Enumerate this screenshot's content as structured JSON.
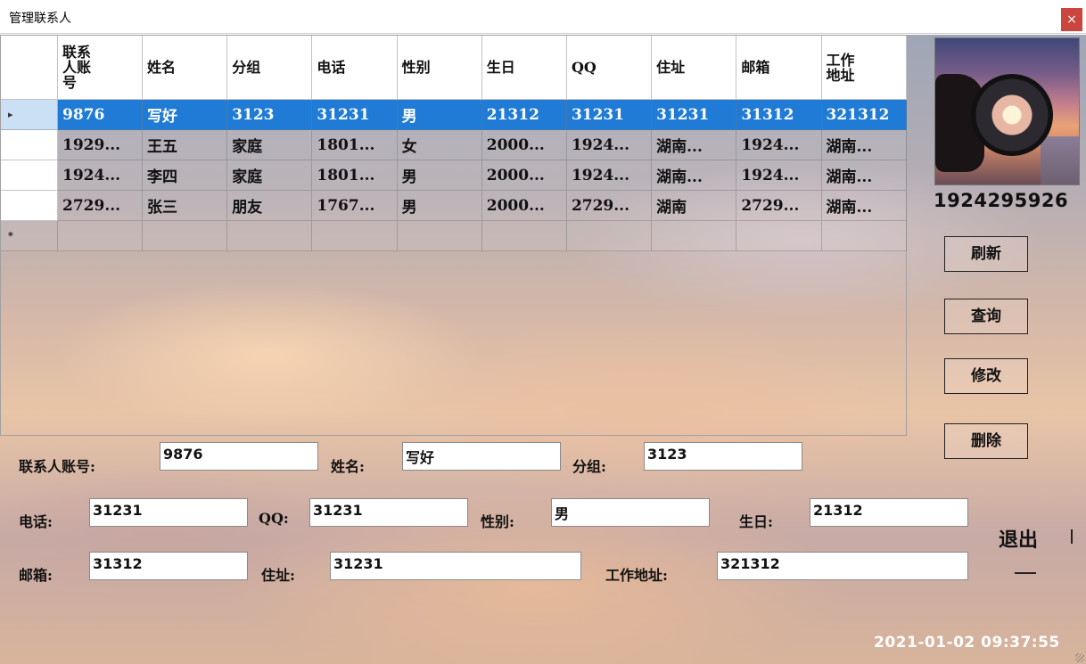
{
  "window": {
    "title": "管理联系人",
    "close_glyph": "×"
  },
  "grid": {
    "columns": [
      "联系\n人账\n号",
      "姓名",
      "分组",
      "电话",
      "性别",
      "生日",
      "QQ",
      "住址",
      "邮箱",
      "工作\n地址"
    ],
    "rows": [
      {
        "selected": true,
        "cells": [
          "9876",
          "写好",
          "3123",
          "31231",
          "男",
          "21312",
          "31231",
          "31231",
          "31312",
          "321312"
        ]
      },
      {
        "selected": false,
        "cells": [
          "1929...",
          "王五",
          "家庭",
          "1801...",
          "女",
          "2000...",
          "1924...",
          "湖南...",
          "1924...",
          "湖南..."
        ]
      },
      {
        "selected": false,
        "cells": [
          "1924...",
          "李四",
          "家庭",
          "1801...",
          "男",
          "2000...",
          "1924...",
          "湖南...",
          "1924...",
          "湖南..."
        ]
      },
      {
        "selected": false,
        "cells": [
          "2729...",
          "张三",
          "朋友",
          "1767...",
          "男",
          "2000...",
          "2729...",
          "湖南",
          "2729...",
          "湖南..."
        ]
      }
    ],
    "current_row_marker": "▸",
    "new_row_marker": "*"
  },
  "profile": {
    "account": "1924295926"
  },
  "buttons": {
    "refresh": "刷新",
    "query": "查询",
    "modify": "修改",
    "delete": "删除"
  },
  "form": {
    "account_label": "联系人账号:",
    "account_value": "9876",
    "name_label": "姓名:",
    "name_value": "写好",
    "group_label": "分组:",
    "group_value": "3123",
    "phone_label": "电话:",
    "phone_value": "31231",
    "qq_label": "QQ:",
    "qq_value": "31231",
    "gender_label": "性别:",
    "gender_value": "男",
    "birthday_label": "生日:",
    "birthday_value": "21312",
    "email_label": "邮箱:",
    "email_value": "31312",
    "address_label": "住址:",
    "address_value": "31231",
    "work_address_label": "工作地址:",
    "work_address_value": "321312"
  },
  "exit_label": "退出",
  "clock": "2021-01-02 09:37:55",
  "colors": {
    "selection": "#1f7bd6",
    "close_button": "#c9453d"
  }
}
